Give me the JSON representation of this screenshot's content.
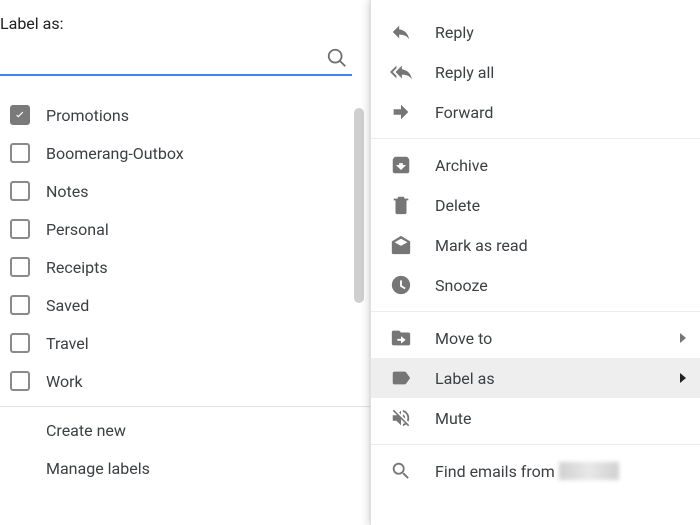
{
  "labelas": {
    "title": "Label as:",
    "search_placeholder": "",
    "items": [
      {
        "label": "Promotions",
        "checked": true
      },
      {
        "label": "Boomerang-Outbox",
        "checked": false
      },
      {
        "label": "Notes",
        "checked": false
      },
      {
        "label": "Personal",
        "checked": false
      },
      {
        "label": "Receipts",
        "checked": false
      },
      {
        "label": "Saved",
        "checked": false
      },
      {
        "label": "Travel",
        "checked": false
      },
      {
        "label": "Work",
        "checked": false
      }
    ],
    "create_new": "Create new",
    "manage_labels": "Manage labels"
  },
  "context_menu": {
    "reply": "Reply",
    "reply_all": "Reply all",
    "forward": "Forward",
    "archive": "Archive",
    "delete": "Delete",
    "mark_as_read": "Mark as read",
    "snooze": "Snooze",
    "move_to": "Move to",
    "label_as": "Label as",
    "mute": "Mute",
    "find_emails": "Find emails from"
  }
}
